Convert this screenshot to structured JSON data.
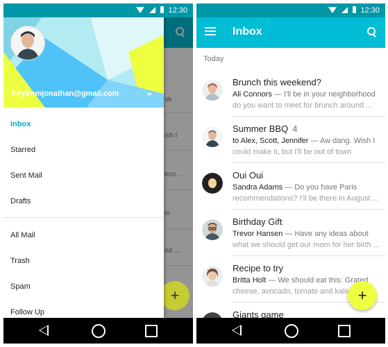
{
  "left_screen": {
    "status_bar": {
      "time": "12:30"
    },
    "account": {
      "email": "heyfromjonathan@gmail.com"
    },
    "drawer": {
      "primary_items": [
        {
          "label": "Inbox",
          "active": true
        },
        {
          "label": "Starred",
          "active": false
        },
        {
          "label": "Sent Mail",
          "active": false
        },
        {
          "label": "Drafts",
          "active": false
        }
      ],
      "secondary_items": [
        {
          "label": "All Mail"
        },
        {
          "label": "Trash"
        },
        {
          "label": "Spam"
        },
        {
          "label": "Follow Up"
        }
      ]
    },
    "background_fragments": [
      "ok",
      "ish I",
      "eco...",
      "in",
      "ed ..."
    ],
    "fab_label": "+"
  },
  "right_screen": {
    "status_bar": {
      "time": "12:30"
    },
    "app_bar": {
      "title": "Inbox"
    },
    "section_label": "Today",
    "emails": [
      {
        "subject": "Brunch this weekend?",
        "count": "",
        "sender": "Ali Connors",
        "preview_line1": " — I'll be in your neighborhood",
        "preview_line2": "do you want to meet for brunch around ..."
      },
      {
        "subject": "Summer BBQ",
        "count": "4",
        "sender": "to Alex, Scott, Jennifer",
        "preview_line1": " — Aw dang. Wish I",
        "preview_line2": "could make it, but I'll be out of town"
      },
      {
        "subject": "Oui Oui",
        "count": "",
        "sender": "Sandra Adams",
        "preview_line1": " — Do you have Paris",
        "preview_line2": "recommendations? I'll be there in August ..."
      },
      {
        "subject": "Birthday Gift",
        "count": "",
        "sender": "Trevor Hansen",
        "preview_line1": " — Have any ideas about",
        "preview_line2": "what we should get our mom for her birth ..."
      },
      {
        "subject": "Recipe to try",
        "count": "",
        "sender": "Britta Holt",
        "preview_line1": " — We should eat this: Grated",
        "preview_line2": "cheese, avocado, tomato and kale"
      },
      {
        "subject": "Giants game",
        "count": "",
        "sender": "",
        "preview_line1": "",
        "preview_line2": ""
      }
    ],
    "fab_label": "+"
  },
  "colors": {
    "status_bar": "#0097a7",
    "app_bar": "#00bcd4",
    "accent": "#eeff41",
    "active_item": "#00acc1"
  }
}
